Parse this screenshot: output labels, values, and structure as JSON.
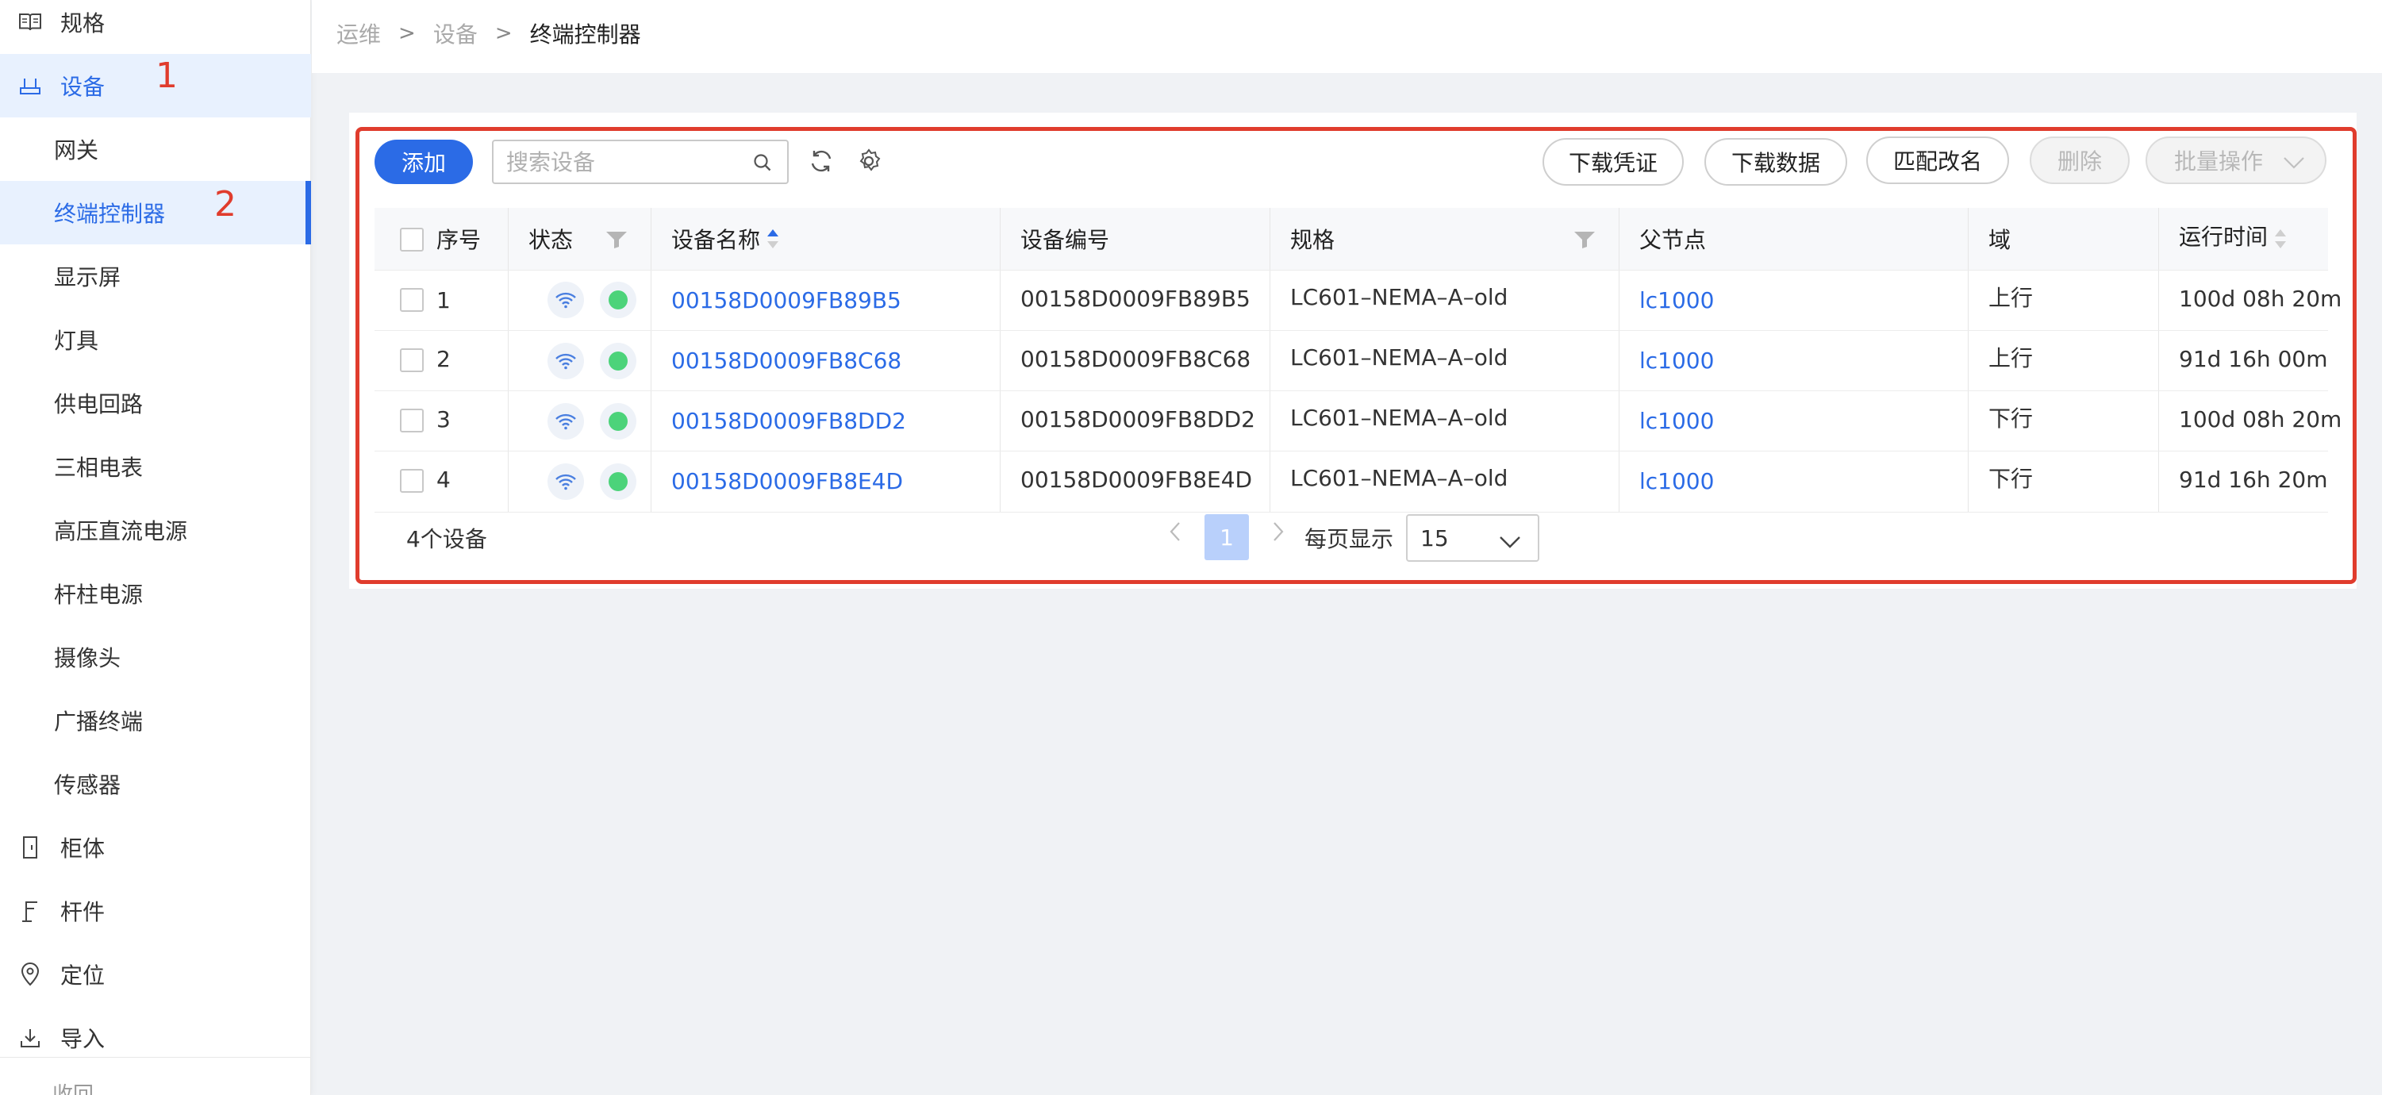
{
  "sidebar": {
    "items": [
      {
        "label": "规格",
        "icon": "book-icon"
      },
      {
        "label": "设备",
        "icon": "router-icon",
        "annotation": "1"
      },
      {
        "label": "网关"
      },
      {
        "label": "终端控制器",
        "annotation": "2"
      },
      {
        "label": "显示屏"
      },
      {
        "label": "灯具"
      },
      {
        "label": "供电回路"
      },
      {
        "label": "三相电表"
      },
      {
        "label": "高压直流电源"
      },
      {
        "label": "杆柱电源"
      },
      {
        "label": "摄像头"
      },
      {
        "label": "广播终端"
      },
      {
        "label": "传感器"
      },
      {
        "label": "柜体",
        "icon": "cabinet-icon"
      },
      {
        "label": "杆件",
        "icon": "pole-icon"
      },
      {
        "label": "定位",
        "icon": "location-pin-icon"
      },
      {
        "label": "导入",
        "icon": "import-icon"
      }
    ],
    "collapse_label": "收回"
  },
  "breadcrumb": {
    "items": [
      "运维",
      "设备",
      "终端控制器"
    ],
    "separator": ">"
  },
  "toolbar": {
    "add_label": "添加",
    "search_placeholder": "搜索设备",
    "download_credentials": "下载凭证",
    "download_data": "下载数据",
    "match_rename": "匹配改名",
    "delete": "删除",
    "batch_ops": "批量操作"
  },
  "table": {
    "headers": {
      "index": "序号",
      "status": "状态",
      "name": "设备名称",
      "code": "设备编号",
      "spec": "规格",
      "parent": "父节点",
      "domain": "域",
      "uptime": "运行时间"
    },
    "rows": [
      {
        "index": "1",
        "name": "00158D0009FB89B5",
        "code": "00158D0009FB89B5",
        "spec": "LC601–NEMA–A–old",
        "parent": "lc1000",
        "domain": "上行",
        "uptime": "100d 08h 20m"
      },
      {
        "index": "2",
        "name": "00158D0009FB8C68",
        "code": "00158D0009FB8C68",
        "spec": "LC601–NEMA–A–old",
        "parent": "lc1000",
        "domain": "上行",
        "uptime": "91d 16h 00m"
      },
      {
        "index": "3",
        "name": "00158D0009FB8DD2",
        "code": "00158D0009FB8DD2",
        "spec": "LC601–NEMA–A–old",
        "parent": "lc1000",
        "domain": "下行",
        "uptime": "100d 08h 20m"
      },
      {
        "index": "4",
        "name": "00158D0009FB8E4D",
        "code": "00158D0009FB8E4D",
        "spec": "LC601–NEMA–A–old",
        "parent": "lc1000",
        "domain": "下行",
        "uptime": "91d 16h 20m"
      }
    ]
  },
  "pagination": {
    "total_label": "4个设备",
    "current_page": "1",
    "per_page_label": "每页显示",
    "per_page_value": "15"
  },
  "colors": {
    "accent": "#2b6be6",
    "annotation": "#e03c2d",
    "status_online": "#4cd37a"
  }
}
